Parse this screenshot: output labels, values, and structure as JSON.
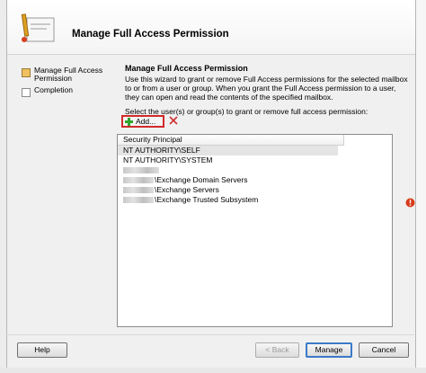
{
  "header": {
    "title": "Manage Full Access Permission",
    "icon": "wizard-icon"
  },
  "steps": [
    {
      "label": "Manage Full Access Permission",
      "active": true
    },
    {
      "label": "Completion",
      "active": false
    }
  ],
  "content": {
    "title": "Manage Full Access Permission",
    "description": "Use this wizard to grant or remove Full Access permissions for the selected mailbox to or from a user or group. When you grant the Full Access permission to a user, they can open and read the contents of the specified mailbox.",
    "select_label": "Select the user(s) or group(s) to grant or remove full access permission:",
    "add_label": "Add...",
    "add_icon": "green-plus-icon",
    "remove_icon": "red-x-icon"
  },
  "list": {
    "column_header": "Security Principal",
    "rows": [
      {
        "text": "NT AUTHORITY\\SELF",
        "selected": true,
        "redacted": false
      },
      {
        "text": "NT AUTHORITY\\SYSTEM",
        "selected": false,
        "redacted": false
      },
      {
        "text": "",
        "selected": false,
        "redacted": true
      },
      {
        "text": "\\Exchange Domain Servers",
        "selected": false,
        "redacted": true
      },
      {
        "text": "\\Exchange Servers",
        "selected": false,
        "redacted": true
      },
      {
        "text": "\\Exchange Trusted Subsystem",
        "selected": false,
        "redacted": true
      }
    ]
  },
  "buttons": {
    "help": "Help",
    "back": "< Back",
    "manage": "Manage",
    "cancel": "Cancel"
  },
  "colors": {
    "highlight_border": "#d02a2a",
    "default_button": "#3a7ac8"
  }
}
